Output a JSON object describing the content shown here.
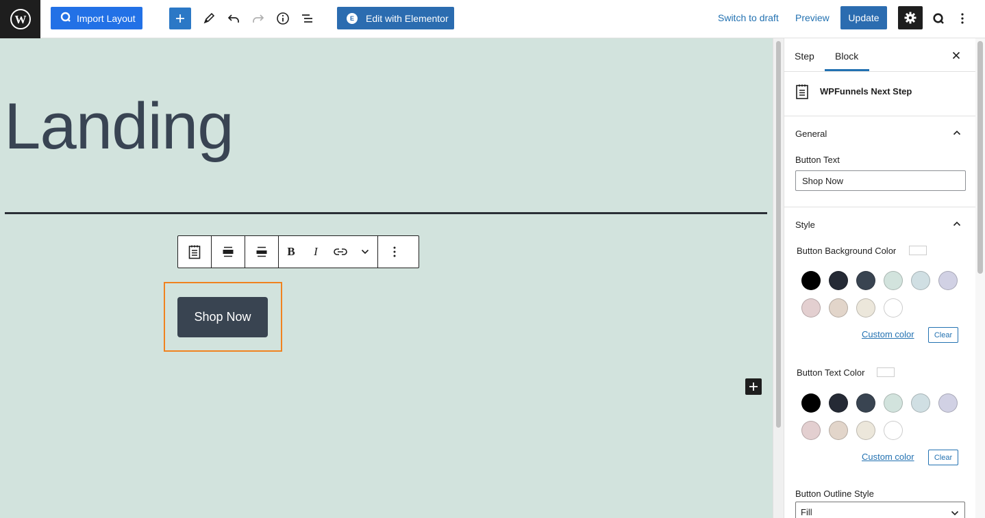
{
  "topbar": {
    "import_layout_label": "Import Layout",
    "edit_elementor_label": "Edit with Elementor",
    "switch_to_draft_label": "Switch to draft",
    "preview_label": "Preview",
    "update_label": "Update",
    "icons": [
      "wordpress-logo-icon",
      "plus-icon",
      "pen-icon",
      "undo-icon",
      "redo-icon",
      "info-icon",
      "list-view-icon",
      "gear-icon",
      "q-icon",
      "more-vertical-icon"
    ]
  },
  "canvas": {
    "heading": "Landing",
    "button_text": "Shop Now",
    "background_color": "#d2e3dd",
    "selection_color": "#f0821f"
  },
  "block_toolbar": {
    "items": [
      "block-type-icon",
      "align-wide-icon",
      "align-full-icon",
      "bold-icon",
      "italic-icon",
      "link-icon",
      "chevron-down-icon",
      "more-vertical-icon"
    ],
    "bold_label": "B",
    "italic_label": "I"
  },
  "sidebar": {
    "tabs": [
      {
        "label": "Step",
        "active": false
      },
      {
        "label": "Block",
        "active": true
      }
    ],
    "block_name": "WPFunnels Next Step",
    "general": {
      "title": "General",
      "button_text_label": "Button Text",
      "button_text_value": "Shop Now"
    },
    "style": {
      "title": "Style",
      "bg_color_label": "Button Background Color",
      "text_color_label": "Button Text Color",
      "custom_color_label": "Custom color",
      "clear_label": "Clear",
      "palette": [
        "#000000",
        "#252a35",
        "#394451",
        "#d2e3dd",
        "#d0dfe3",
        "#d1d1e4",
        "#e3cfd0",
        "#e2d5ca",
        "#ece7db",
        "#ffffff"
      ],
      "outline_style_label": "Button Outline Style",
      "outline_style_value": "Fill"
    }
  }
}
